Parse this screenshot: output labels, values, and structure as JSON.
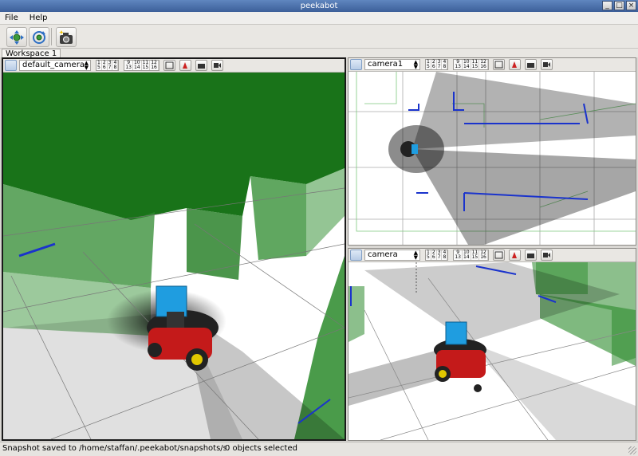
{
  "window": {
    "title": "peekabot",
    "buttons": [
      "_",
      "□",
      "×"
    ]
  },
  "menu": {
    "items": [
      "File",
      "Help"
    ]
  },
  "toolbar": {
    "icons": [
      "move-icon",
      "rotate-icon",
      "snapshot-camera-icon"
    ]
  },
  "tabs": [
    {
      "label": "Workspace 1"
    }
  ],
  "views": {
    "main": {
      "camera": "default_camera"
    },
    "top_right": {
      "camera": "camera1"
    },
    "bottom_right": {
      "camera": "camera"
    }
  },
  "viewport_grid": [
    "1",
    "2",
    "3",
    "4",
    "5",
    "6",
    "7",
    "8",
    "9",
    "10",
    "11",
    "12",
    "13",
    "14",
    "15",
    "16"
  ],
  "view_tools": [
    "save-view-icon",
    "orthographic-icon",
    "camera-snapshot-icon",
    "record-icon"
  ],
  "status": {
    "message": "Snapshot saved to /home/staffan/.peekabot/snapshots/snapshot",
    "selection": "0 objects selected"
  },
  "colors": {
    "title_bar": "#4a6fab",
    "wall": "#2e8b2e",
    "laser": "#1a33cc",
    "robot_body": "#c41a1a",
    "robot_sensor": "#1f9de0"
  }
}
